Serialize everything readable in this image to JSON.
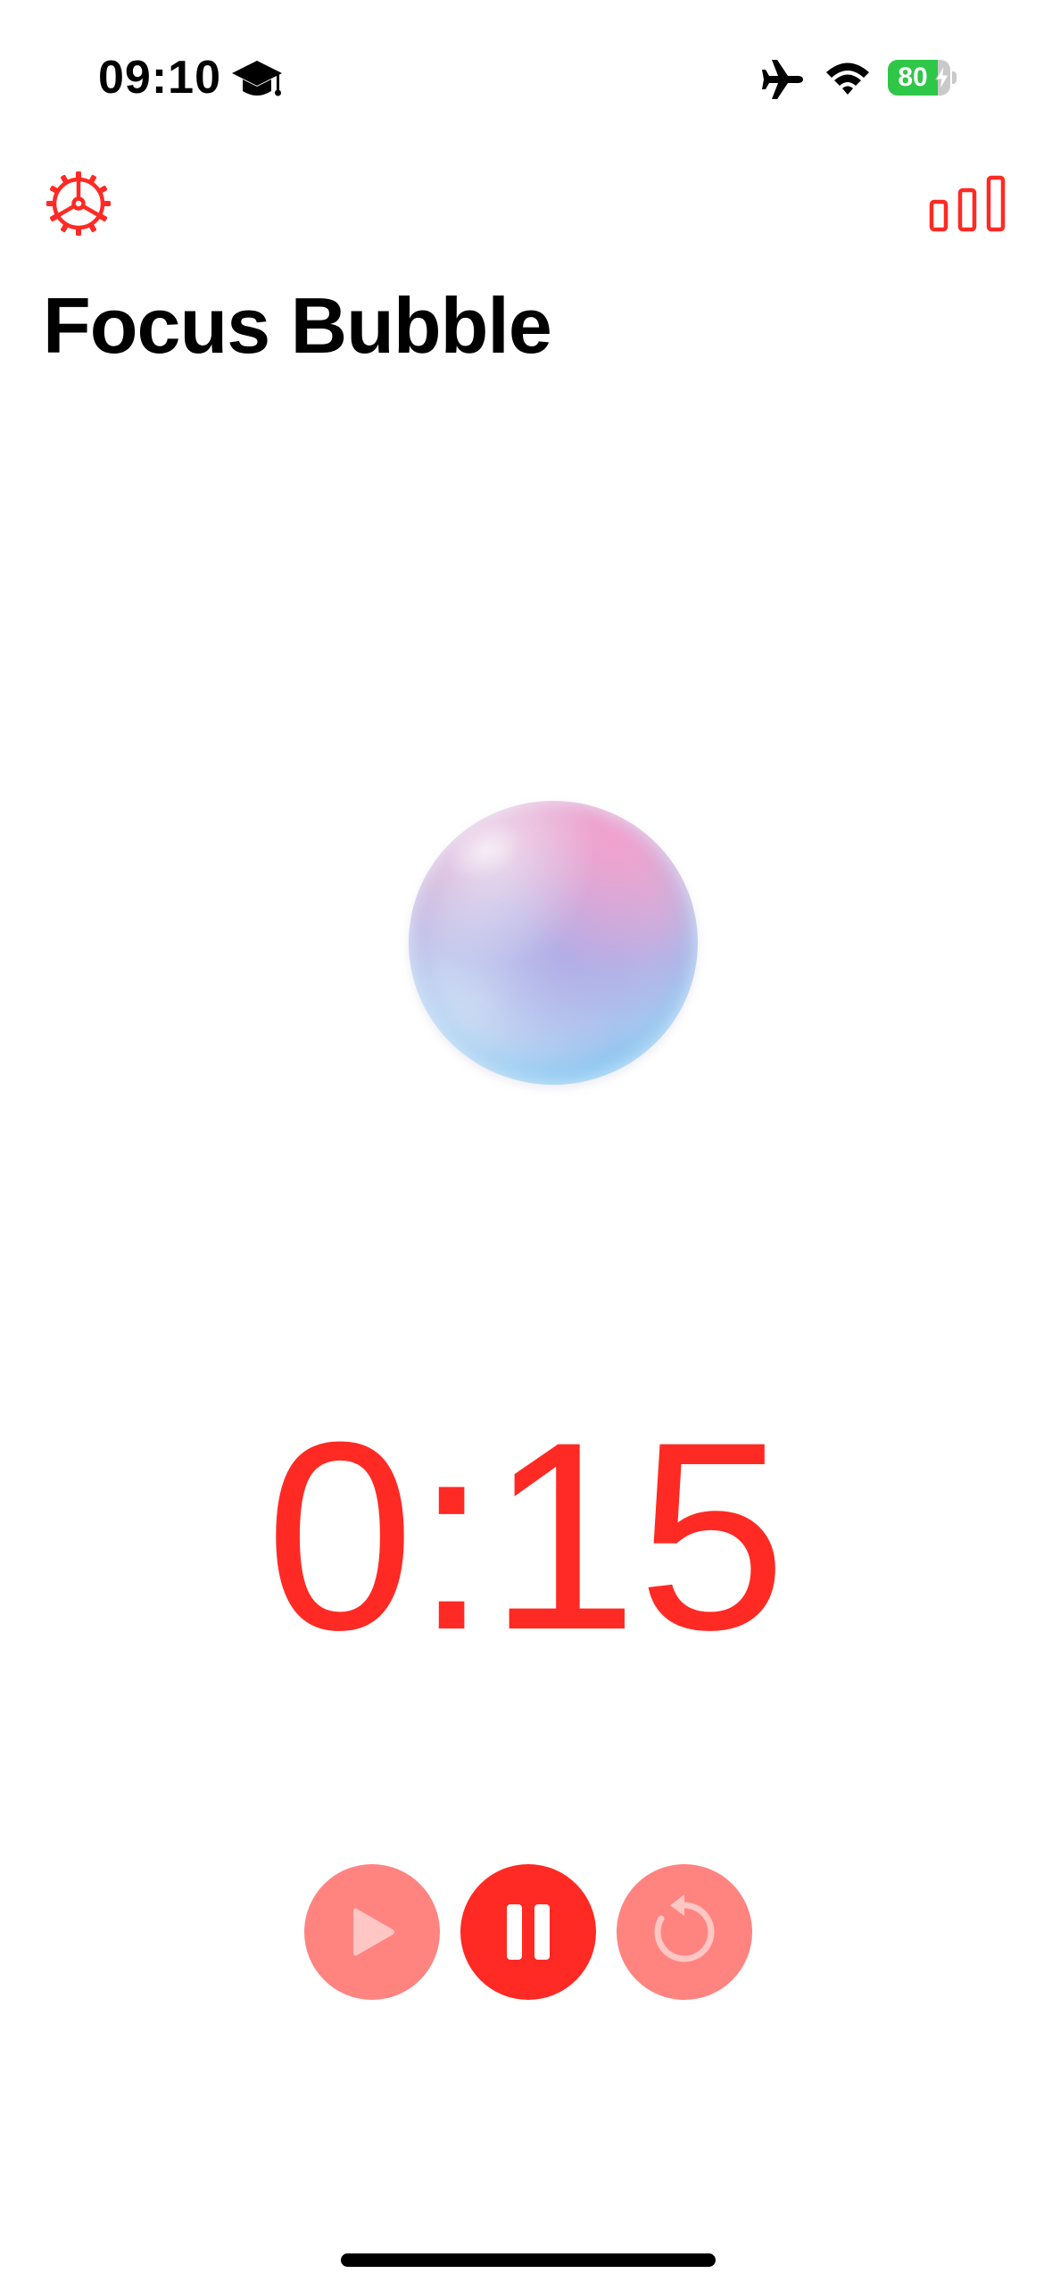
{
  "status_bar": {
    "time": "09:10",
    "battery_level": "80",
    "battery_fraction": 0.8,
    "icons": [
      "graduation-cap-icon",
      "airplane-icon",
      "wifi-icon",
      "battery-icon",
      "charging-bolt-icon"
    ],
    "battery_color": "#2fc748"
  },
  "nav": {
    "settings_icon": "gear-icon",
    "stats_icon": "bar-chart-icon"
  },
  "title": "Focus Bubble",
  "timer": {
    "display": "0:15"
  },
  "controls": {
    "play_icon": "play-icon",
    "pause_icon": "pause-icon",
    "reset_icon": "reset-icon"
  },
  "colors": {
    "accent": "#ff2a24",
    "accent_disabled": "#ff8480"
  }
}
